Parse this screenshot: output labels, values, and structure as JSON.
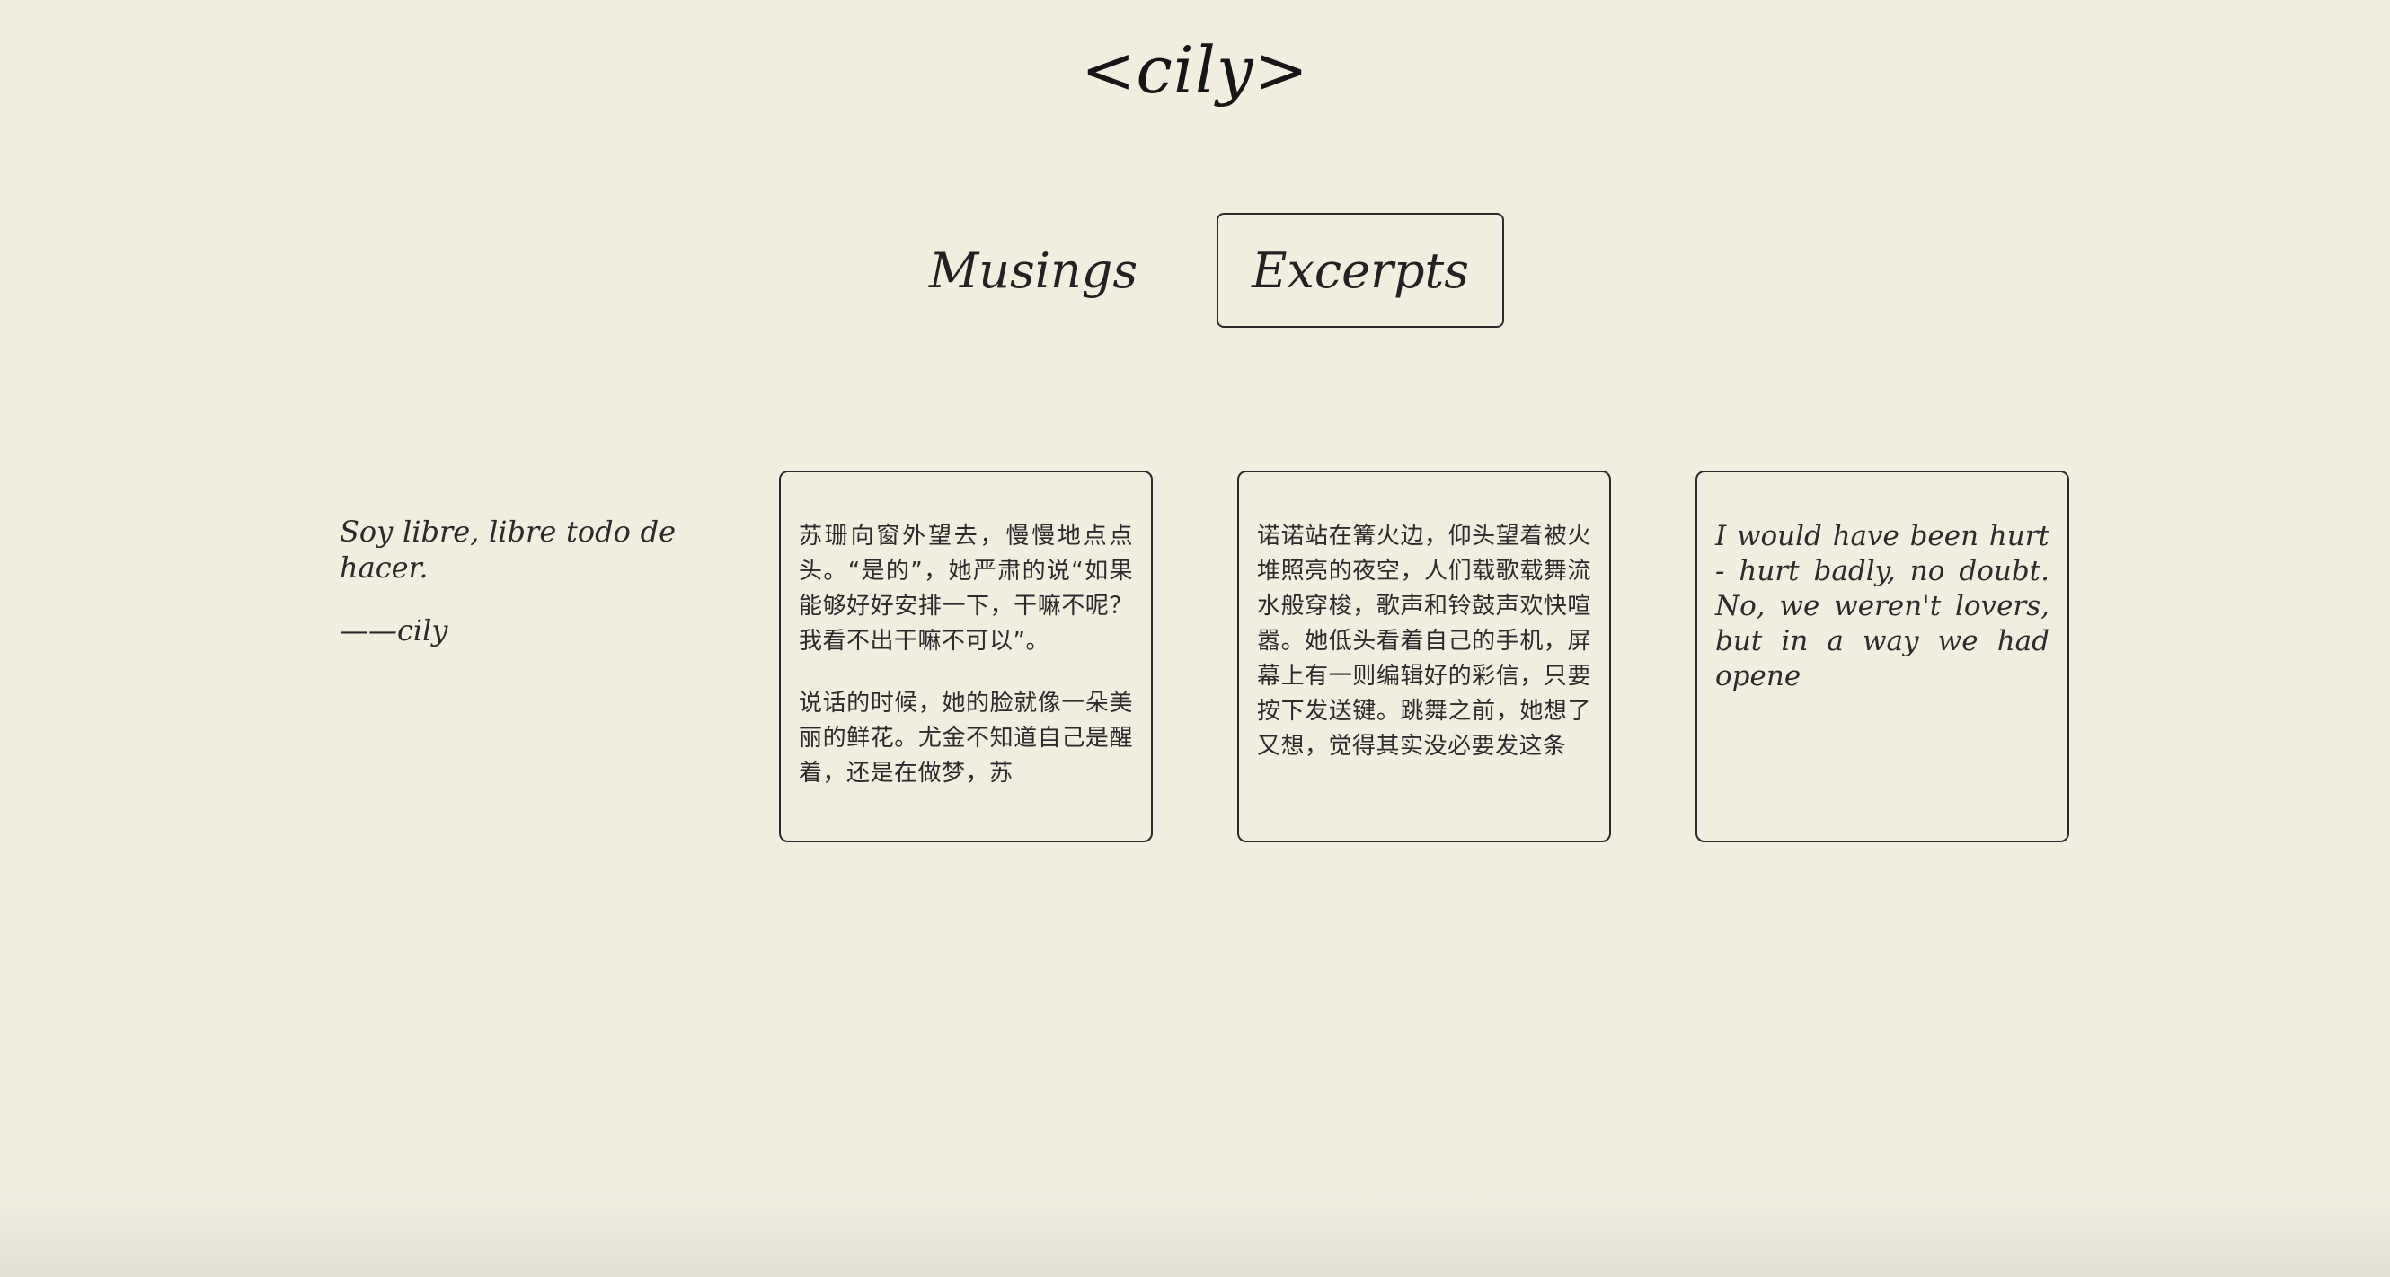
{
  "site": {
    "title": "<cily>"
  },
  "nav": {
    "tabs": [
      {
        "label": "Musings",
        "active": false
      },
      {
        "label": "Excerpts",
        "active": true
      }
    ]
  },
  "quote": {
    "text": "Soy libre, libre todo de hacer.",
    "signature": "——cily"
  },
  "cards": [
    {
      "paragraphs": [
        "苏珊向窗外望去，慢慢地点点头。“是的”，她严肃的说“如果能够好好安排一下，干嘛不呢？我看不出干嘛不可以”。",
        "说话的时候，她的脸就像一朵美丽的鲜花。尤金不知道自己是醒着，还是在做梦，苏"
      ]
    },
    {
      "paragraphs": [
        "诺诺站在篝火边，仰头望着被火堆照亮的夜空，人们载歌载舞流水般穿梭，歌声和铃鼓声欢快喧嚣。她低头看着自己的手机，屏幕上有一则编辑好的彩信，只要按下发送键。跳舞之前，她想了又想，觉得其实没必要发这条"
      ]
    },
    {
      "paragraphs": [
        "I would have been hurt - hurt badly, no doubt. No, we weren't lovers, but in a way we had opene"
      ]
    }
  ],
  "colors": {
    "background": "#f1eee0",
    "ink": "#1f1f1f",
    "border": "#2b2b2b"
  }
}
